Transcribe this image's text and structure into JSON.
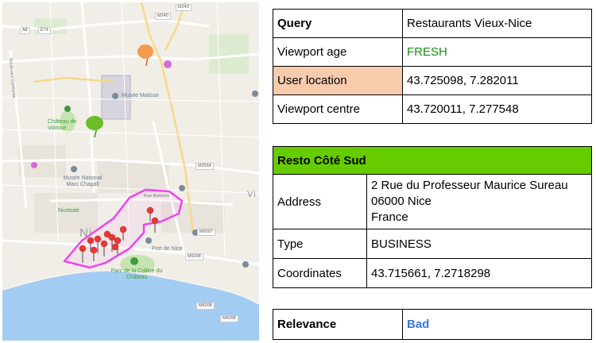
{
  "map": {
    "labels": {
      "musee_matisse": "Musée Matisse",
      "chateau_valrose": "Château de Valrose",
      "musee_chagall": "Musée National Marc Chagall",
      "nice_etoile": "Nicetoile",
      "port_de_nice": "Port de Nice",
      "parc_chateau": "Parc de la Colline du Château",
      "rue_barberis": "Rue Barberis",
      "bd_gambetta": "Boulevard Gambetta",
      "nice_big": "Ni",
      "vi": "Vi"
    },
    "road_shields": [
      "A8",
      "E74",
      "M240",
      "M240",
      "M2564",
      "M6007",
      "M6098",
      "M6098",
      "M6098"
    ],
    "colors": {
      "water": "#a3ccf3",
      "park": "#c8e3b2",
      "search_area": "#ee44ee",
      "user_pin": "#f39b4f",
      "centre_pin": "#6bbe2a",
      "result_pin": "#e53935"
    }
  },
  "query": {
    "rows": [
      {
        "key": "Query",
        "value": "Restaurants Vieux-Nice"
      },
      {
        "key": "Viewport age",
        "value": "FRESH"
      },
      {
        "key": "User location",
        "value": "43.725098, 7.282011"
      },
      {
        "key": "Viewport centre",
        "value": "43.720011, 7.277548"
      }
    ]
  },
  "result": {
    "name": "Resto Côté Sud",
    "address_label": "Address",
    "address_lines": [
      "2 Rue du Professeur Maurice Sureau",
      "06000 Nice",
      "France"
    ],
    "type_label": "Type",
    "type_value": "BUSINESS",
    "coords_label": "Coordinates",
    "coords_value": "43.715661, 7.2718298"
  },
  "relevance": {
    "label": "Relevance",
    "value": "Bad"
  }
}
